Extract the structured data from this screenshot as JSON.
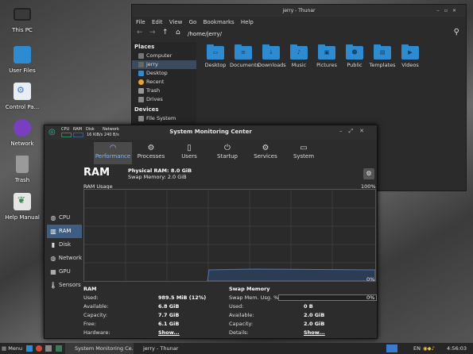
{
  "desktop": {
    "icons": [
      "This PC",
      "User Files",
      "Control Pa...",
      "Network",
      "Trash",
      "Help Manual"
    ]
  },
  "thunar": {
    "title": "jerry - Thunar",
    "menus": [
      "File",
      "Edit",
      "View",
      "Go",
      "Bookmarks",
      "Help"
    ],
    "path": "/home/jerry/",
    "places_header": "Places",
    "places": [
      "Computer",
      "jerry",
      "Desktop",
      "Recent",
      "Trash",
      "Drives"
    ],
    "devices_header": "Devices",
    "devices": [
      "File System"
    ],
    "folders": [
      "Desktop",
      "Documents",
      "Downloads",
      "Music",
      "Pictures",
      "Public",
      "Templates",
      "Videos"
    ]
  },
  "smc": {
    "title": "System Monitoring Center",
    "mini": {
      "cpu": "CPU",
      "ram": "RAM",
      "disk": "Disk",
      "network": "Network",
      "rates": "16 KiB/s 240 B/s"
    },
    "tabs": [
      "Performance",
      "Processes",
      "Users",
      "Startup",
      "Services",
      "System"
    ],
    "sidebar": [
      "CPU",
      "RAM",
      "Disk",
      "Network",
      "GPU",
      "Sensors"
    ],
    "heading": "RAM",
    "physical": "Physical RAM: 8.0 GiB",
    "swap_total": "Swap Memory: 2.0 GiB",
    "usage_label": "RAM Usage",
    "max_label": "100%",
    "min_label": "0%",
    "ram": {
      "header": "RAM",
      "used_l": "Used:",
      "used": "989.5 MiB (12%)",
      "avail_l": "Available:",
      "avail": "6.8 GiB",
      "cap_l": "Capacity:",
      "cap": "7.7 GiB",
      "free_l": "Free:",
      "free": "6.1 GiB",
      "hw_l": "Hardware:",
      "hw": "Show..."
    },
    "swap": {
      "header": "Swap Memory",
      "usage_l": "Swap Mem. Usg. %:",
      "usage": "0%",
      "used_l": "Used:",
      "used": "0 B",
      "avail_l": "Available:",
      "avail": "2.0 GiB",
      "cap_l": "Capacity:",
      "cap": "2.0 GiB",
      "det_l": "Details:",
      "det": "Show..."
    }
  },
  "taskbar": {
    "menu": "Menu",
    "task1": "System Monitoring Ce...",
    "task2": "jerry - Thunar",
    "lang": "EN",
    "time": "4:56:03 pm"
  },
  "colors": {
    "accent": "#3e5d85",
    "folder": "#2f8bd0",
    "graph_line": "#4b79b8"
  }
}
